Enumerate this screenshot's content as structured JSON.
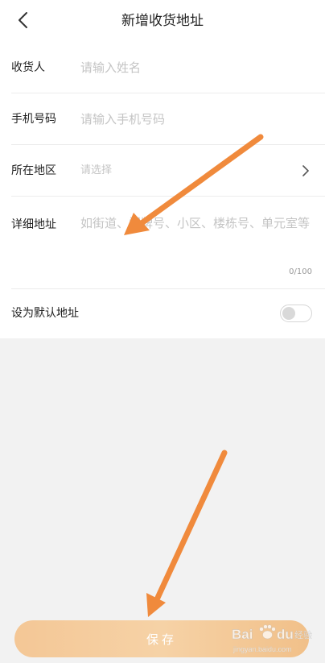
{
  "header": {
    "title": "新增收货地址",
    "back_icon": "chevron-left-icon"
  },
  "form": {
    "name": {
      "label": "收货人",
      "placeholder": "请输入姓名"
    },
    "phone": {
      "label": "手机号码",
      "placeholder": "请输入手机号码"
    },
    "region": {
      "label": "所在地区",
      "value": "请选择",
      "icon": "chevron-right-icon"
    },
    "address": {
      "label": "详细地址",
      "placeholder": "如街道、门牌号、小区、楼栋号、单元室等",
      "counter": "0/100"
    },
    "default": {
      "label": "设为默认地址",
      "enabled": false
    }
  },
  "footer": {
    "save_label": "保存"
  },
  "watermark": {
    "logo_text": "Bai du 经验",
    "url": "jingyan.baidu.com"
  },
  "colors": {
    "accent_arrow": "#f08a3c",
    "button_gradient_start": "#f4c796",
    "button_gradient_end": "#f1c089",
    "placeholder": "#c4c4c4"
  }
}
